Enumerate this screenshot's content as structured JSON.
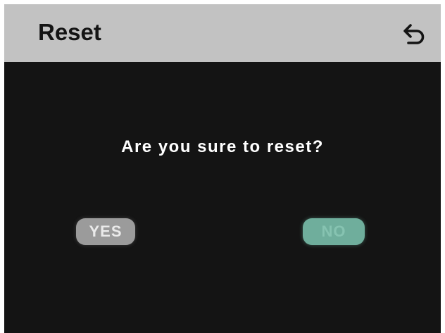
{
  "header": {
    "title": "Reset",
    "back_icon": "back-arrow-icon"
  },
  "dialog": {
    "question": "Are you sure to reset?",
    "yes_label": "YES",
    "no_label": "NO",
    "selected": "NO"
  },
  "colors": {
    "header_bg": "#c2c2c2",
    "screen_bg": "#141414",
    "yes_button": "#9b9b9b",
    "no_button_selected": "#6fae9c"
  }
}
